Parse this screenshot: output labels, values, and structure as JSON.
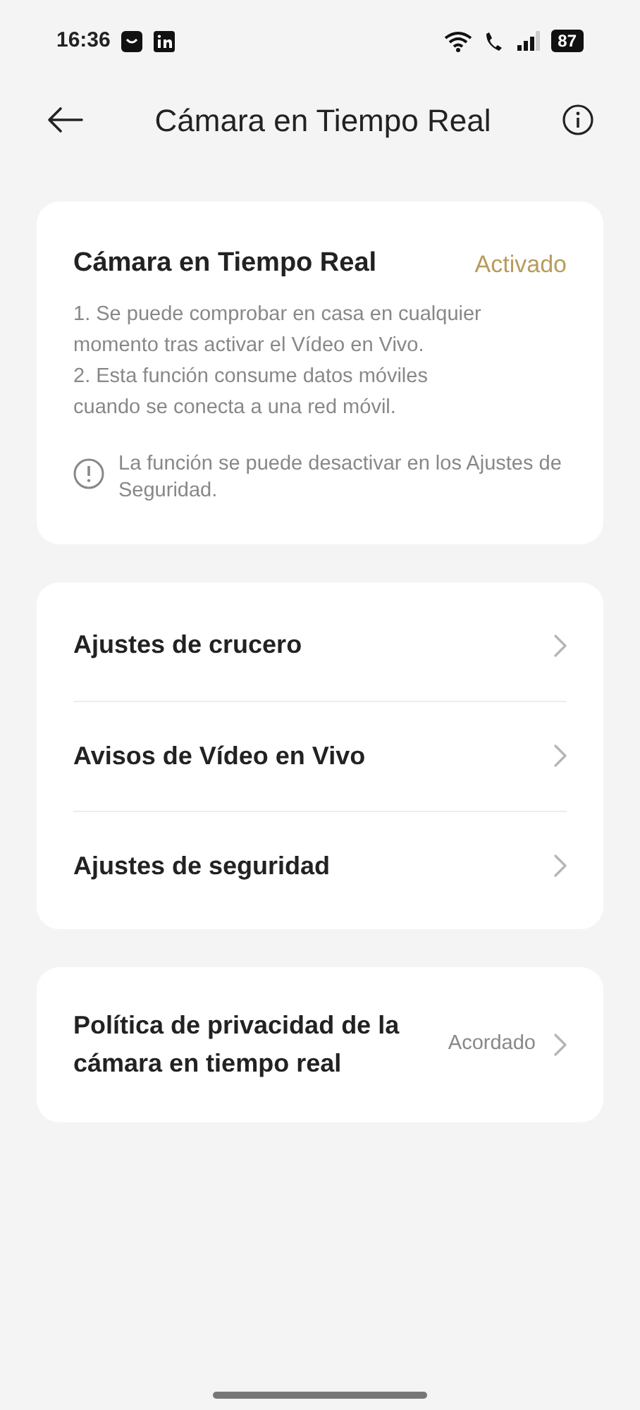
{
  "status_bar": {
    "time": "16:36",
    "battery": "87"
  },
  "header": {
    "title": "Cámara en Tiempo Real"
  },
  "feature_card": {
    "title": "Cámara en Tiempo Real",
    "status": "Activado",
    "description": [
      "1. Se puede comprobar en casa en cualquier momento tras activar el Vídeo en Vivo.",
      "2. Esta función consume datos móviles cuando se conecta a una red móvil."
    ],
    "notice": "La función se puede desactivar en los Ajustes de Seguridad."
  },
  "settings": [
    {
      "label": "Ajustes de crucero"
    },
    {
      "label": "Avisos de Vídeo en Vivo"
    },
    {
      "label": "Ajustes de seguridad"
    }
  ],
  "privacy": {
    "label": "Política de privacidad de la cámara en tiempo real",
    "value": "Acordado"
  }
}
